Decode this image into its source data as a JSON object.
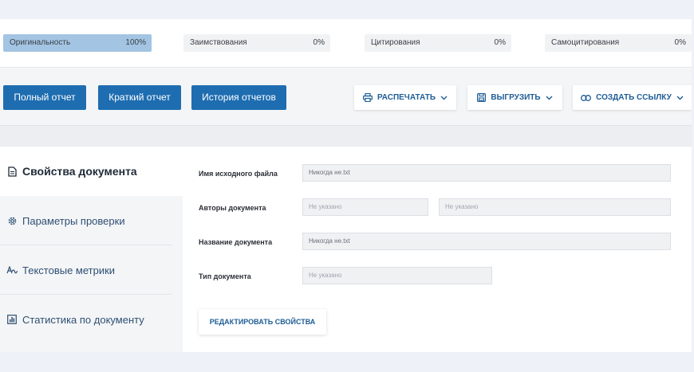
{
  "metrics": [
    {
      "label": "Оригинальность",
      "value": "100%"
    },
    {
      "label": "Заимствования",
      "value": "0%"
    },
    {
      "label": "Цитирования",
      "value": "0%"
    },
    {
      "label": "Самоцитирования",
      "value": "0%"
    }
  ],
  "toolbar": {
    "full_report": "Полный отчет",
    "short_report": "Краткий отчет",
    "report_history": "История отчетов",
    "print": "РАСПЕЧАТАТЬ",
    "export": "ВЫГРУЗИТЬ",
    "create_link": "СОЗДАТЬ ССЫЛКУ"
  },
  "sidebar": {
    "items": [
      {
        "label": "Свойства документа",
        "icon": "document-icon"
      },
      {
        "label": "Параметры проверки",
        "icon": "gear-icon"
      },
      {
        "label": "Текстовые метрики",
        "icon": "text-metrics-icon"
      },
      {
        "label": "Статистика по документу",
        "icon": "bar-chart-icon"
      }
    ]
  },
  "form": {
    "source_file_label": "Имя исходного файла",
    "source_file_value": "Никогда не.txt",
    "authors_label": "Авторы документа",
    "author1_placeholder": "Не указано",
    "author2_placeholder": "Не указано",
    "title_label": "Название документа",
    "title_value": "Никогда не.txt",
    "type_label": "Тип документа",
    "type_placeholder": "Не указано",
    "edit_button": "РЕДАКТИРОВАТЬ СВОЙСТВА"
  },
  "colors": {
    "primary": "#1e6db1",
    "originality_bar": "#a3c4e2",
    "link_text": "#1e5d96"
  }
}
